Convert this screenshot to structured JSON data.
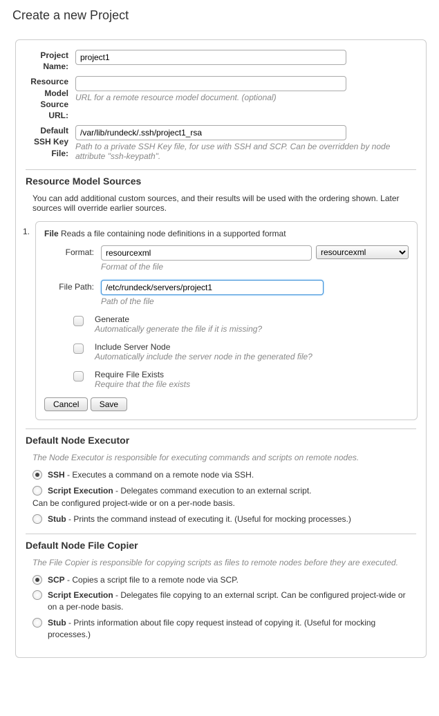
{
  "page": {
    "title": "Create a new Project"
  },
  "fields": {
    "projectName": {
      "label": "Project Name:",
      "value": "project1"
    },
    "resourceUrl": {
      "label": "Resource Model Source URL:",
      "value": "",
      "help": "URL for a remote resource model document. (optional)"
    },
    "sshKey": {
      "label": "Default SSH Key File:",
      "value": "/var/lib/rundeck/.ssh/project1_rsa",
      "help": "Path to a private SSH Key file, for use with SSH and SCP. Can be overridden by node attribute \"ssh-keypath\"."
    }
  },
  "rms": {
    "heading": "Resource Model Sources",
    "desc": "You can add additional custom sources, and their results will be used with the ordering shown. Later sources will override earlier sources.",
    "index": "1.",
    "file": {
      "typeLabel": "File",
      "typeDesc": "Reads a file containing node definitions in a supported format",
      "format": {
        "label": "Format:",
        "value": "resourcexml",
        "help": "Format of the file",
        "select": "resourcexml"
      },
      "path": {
        "label": "File Path:",
        "value": "/etc/rundeck/servers/project1",
        "help": "Path of the file"
      },
      "opts": {
        "generate": {
          "label": "Generate",
          "help": "Automatically generate the file if it is missing?"
        },
        "include": {
          "label": "Include Server Node",
          "help": "Automatically include the server node in the generated file?"
        },
        "require": {
          "label": "Require File Exists",
          "help": "Require that the file exists"
        }
      },
      "buttons": {
        "cancel": "Cancel",
        "save": "Save"
      }
    }
  },
  "executor": {
    "heading": "Default Node Executor",
    "desc": "The Node Executor is responsible for executing commands and scripts on remote nodes.",
    "ssh": {
      "name": "SSH",
      "desc": " - Executes a command on a remote node via SSH."
    },
    "script": {
      "name": "Script Execution",
      "desc": " - Delegates command execution to an external script. ",
      "extra": "Can be configured project-wide or on a per-node basis."
    },
    "stub": {
      "name": "Stub",
      "desc": " - Prints the command instead of executing it. (Useful for mocking processes.)"
    }
  },
  "copier": {
    "heading": "Default Node File Copier",
    "desc": "The File Copier is responsible for copying scripts as files to remote nodes before they are executed.",
    "scp": {
      "name": "SCP",
      "desc": " - Copies a script file to a remote node via SCP."
    },
    "script": {
      "name": "Script Execution",
      "desc": " - Delegates file copying to an external script. Can be configured project-wide or on a per-node basis."
    },
    "stub": {
      "name": "Stub",
      "desc": " - Prints information about file copy request instead of copying it. (Useful for mocking processes.)"
    }
  }
}
